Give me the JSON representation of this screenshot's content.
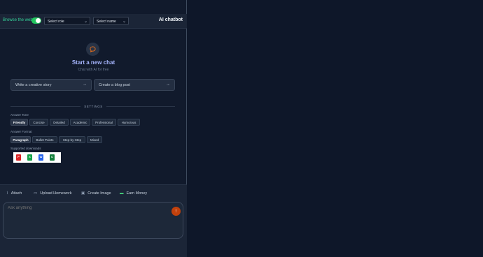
{
  "topbar": {
    "browse_label": "Browse the web",
    "role_select": "Select role",
    "name_select": "Select name",
    "app_title": "AI chatbot"
  },
  "hero": {
    "title": "Start a new chat",
    "subtitle": "Chat with AI for free"
  },
  "suggestions": [
    "Write a creative story",
    "Create a blog post"
  ],
  "settings": {
    "label": "SETTINGS",
    "tone_label": "Answer Tone",
    "tones": [
      "Friendly",
      "Concise",
      "Detailed",
      "Academic",
      "Professional",
      "Humorous"
    ],
    "format_label": "Answer Format",
    "formats": [
      "Paragraph",
      "Bullet Points",
      "Step-by-Step",
      "Mixed"
    ],
    "downloads_label": "Supported downloads",
    "download_types": [
      "pdf-icon",
      "excel-icon",
      "word-icon",
      "csv-icon"
    ]
  },
  "tools": {
    "attach": "Attach",
    "homework": "Upload Homework",
    "image": "Create Image",
    "money": "Earn Money"
  },
  "composer": {
    "placeholder": "Ask anything"
  },
  "colors": {
    "accent": "#c2410c",
    "toggle": "#22c55e",
    "browse": "#34d399",
    "heading": "#a5b4fc"
  }
}
